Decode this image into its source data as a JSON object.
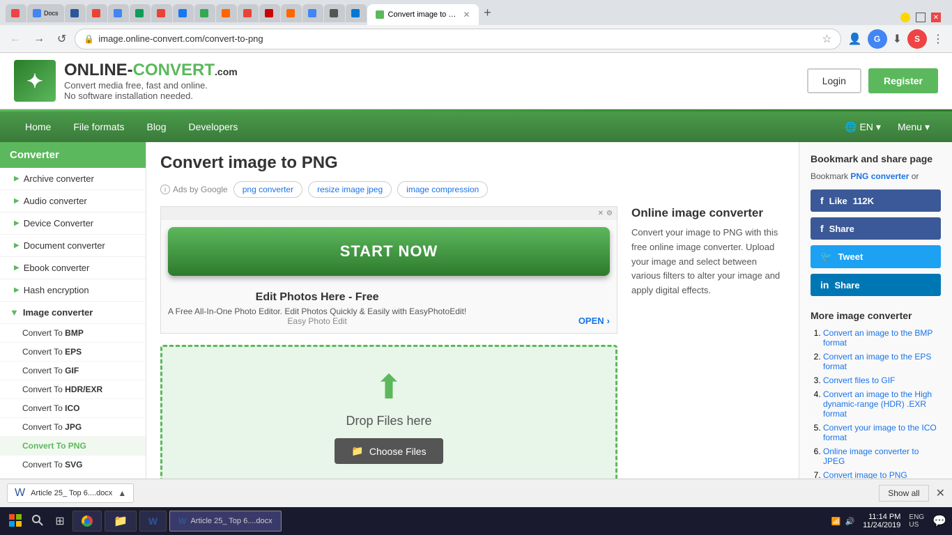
{
  "browser": {
    "url": "image.online-convert.com/convert-to-png",
    "tabs": [
      {
        "label": "G",
        "color": "#e44"
      },
      {
        "label": "Docs",
        "color": "#4285f4"
      },
      {
        "label": "W",
        "color": "#2b579a"
      },
      {
        "label": "M",
        "color": "#ea4335"
      },
      {
        "label": "G",
        "color": "#4285f4"
      },
      {
        "label": "D",
        "color": "#0f9d58"
      },
      {
        "label": "M",
        "color": "#ea4335"
      },
      {
        "label": "F",
        "color": "#1877f2"
      },
      {
        "label": "G",
        "color": "#34a853"
      },
      {
        "label": "A",
        "color": "#ff6600"
      },
      {
        "label": "G",
        "color": "#ea4335"
      },
      {
        "label": "R",
        "color": "#e44"
      },
      {
        "label": "P",
        "color": "#ff6600"
      },
      {
        "label": "G",
        "color": "#4285f4"
      },
      {
        "label": "X",
        "color": "#555"
      },
      {
        "label": "E",
        "color": "#0078d4"
      },
      {
        "label": "active",
        "color": "#5cb85c"
      }
    ],
    "active_tab_title": "Convert image to PNG - Online converter",
    "nav_btns": {
      "back": "←",
      "forward": "→",
      "refresh": "↺"
    }
  },
  "header": {
    "logo_icon": "✦",
    "logo_name_before": "ONLINE-",
    "logo_name_after": "CONVERT",
    "logo_tld": ".com",
    "tagline_line1": "Convert media free, fast and online.",
    "tagline_line2": "No software installation needed.",
    "login_label": "Login",
    "register_label": "Register"
  },
  "nav": {
    "items": [
      {
        "label": "Home",
        "href": "#"
      },
      {
        "label": "File formats",
        "href": "#"
      },
      {
        "label": "Blog",
        "href": "#"
      },
      {
        "label": "Developers",
        "href": "#"
      }
    ],
    "lang": "EN",
    "menu_label": "Menu"
  },
  "sidebar": {
    "title": "Converter",
    "items": [
      {
        "label": "Archive converter",
        "type": "parent"
      },
      {
        "label": "Audio converter",
        "type": "parent"
      },
      {
        "label": "Device Converter",
        "type": "parent"
      },
      {
        "label": "Document converter",
        "type": "parent"
      },
      {
        "label": "Ebook converter",
        "type": "parent"
      },
      {
        "label": "Hash encryption",
        "type": "parent"
      },
      {
        "label": "Image converter",
        "type": "active-parent"
      },
      {
        "label": "Convert To BMP",
        "type": "sub",
        "bold": "BMP"
      },
      {
        "label": "Convert To EPS",
        "type": "sub",
        "bold": "EPS"
      },
      {
        "label": "Convert To GIF",
        "type": "sub",
        "bold": "GIF"
      },
      {
        "label": "Convert To HDR/EXR",
        "type": "sub",
        "bold": "HDR/EXR"
      },
      {
        "label": "Convert To ICO",
        "type": "sub",
        "bold": "ICO"
      },
      {
        "label": "Convert To JPG",
        "type": "sub",
        "bold": "JPG"
      },
      {
        "label": "Convert To PNG",
        "type": "sub-active",
        "bold": "PNG"
      },
      {
        "label": "Convert To SVG",
        "type": "sub",
        "bold": "SVG"
      }
    ]
  },
  "main": {
    "page_title": "Convert image to PNG",
    "ads": {
      "label": "Ads by Google",
      "pills": [
        "png converter",
        "resize image jpeg",
        "image compression"
      ]
    },
    "ad_block": {
      "start_now": "START NOW",
      "product_name": "Edit Photos Here - Free",
      "product_desc": "A Free All-In-One Photo Editor. Edit Photos Quickly & Easily with EasyPhotoEdit!",
      "brand": "Easy Photo Edit",
      "open_label": "OPEN"
    },
    "converter": {
      "title": "Online image converter",
      "description": "Convert your image to PNG with this free online image converter. Upload your image and select between various filters to alter your image and apply digital effects."
    },
    "drop_area": {
      "drop_text": "Drop Files here",
      "choose_label": "Choose Files"
    }
  },
  "right_sidebar": {
    "bookmark_title": "Bookmark and share page",
    "bookmark_desc_before": "Bookmark ",
    "bookmark_link": "PNG converter",
    "bookmark_desc_after": " or",
    "like_count": "112K",
    "buttons": [
      {
        "label": "Like 112K",
        "type": "facebook-like",
        "icon": "f"
      },
      {
        "label": "Share",
        "type": "facebook",
        "icon": "f"
      },
      {
        "label": "Tweet",
        "type": "twitter",
        "icon": "t"
      },
      {
        "label": "Share",
        "type": "linkedin",
        "icon": "in"
      }
    ],
    "more_title": "More image converter",
    "more_items": [
      {
        "label": "Convert an image to the BMP format",
        "href": "#"
      },
      {
        "label": "Convert an image to the EPS format",
        "href": "#"
      },
      {
        "label": "Convert files to GIF",
        "href": "#"
      },
      {
        "label": "Convert an image to the High dynamic-range (HDR) .EXR format",
        "href": "#"
      },
      {
        "label": "Convert your image to the ICO format",
        "href": "#"
      },
      {
        "label": "Online image converter to JPEG",
        "href": "#"
      },
      {
        "label": "Convert image to PNG",
        "href": "#"
      }
    ]
  },
  "bottom_bar": {
    "filename": "Article 25_ Top 6....docx",
    "show_all": "Show all"
  },
  "taskbar": {
    "time": "11:14 PM",
    "date": "11/24/2019",
    "lang": "ENG\nUS"
  }
}
